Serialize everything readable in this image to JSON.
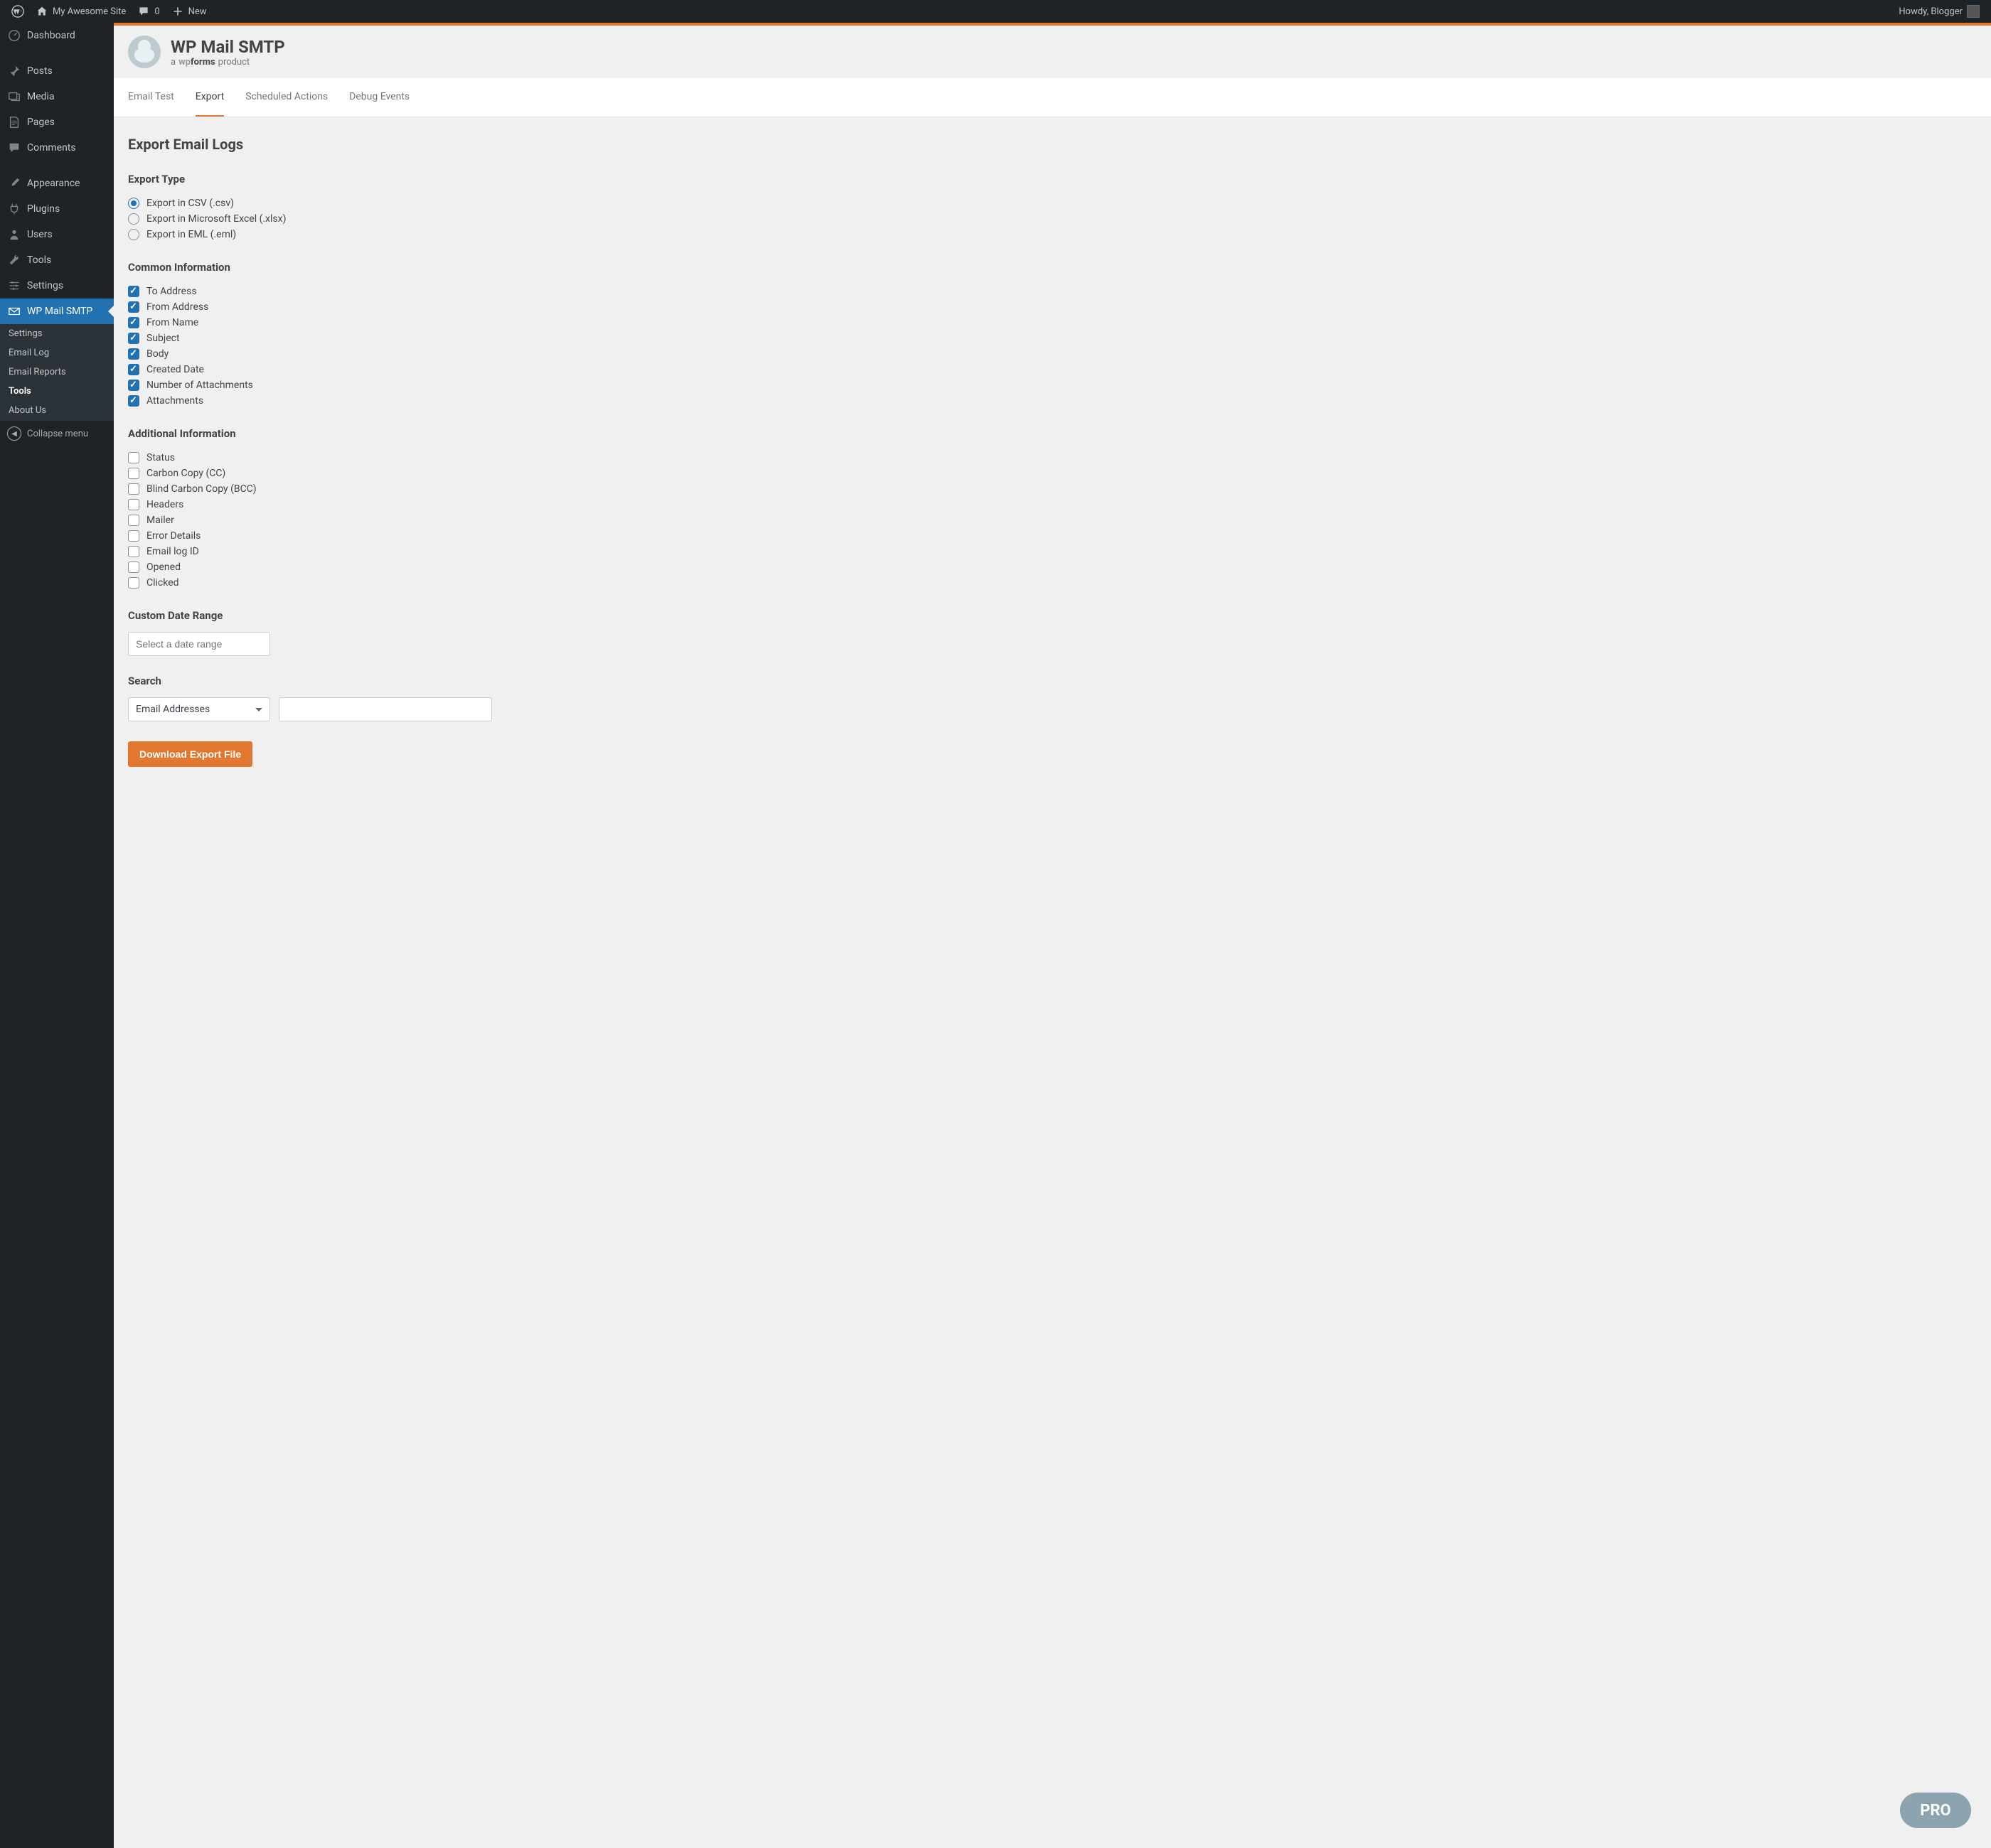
{
  "adminbar": {
    "site_name": "My Awesome Site",
    "comments_count": "0",
    "new_label": "New",
    "howdy": "Howdy, Blogger"
  },
  "sidebar": {
    "items": [
      {
        "icon": "dashboard",
        "label": "Dashboard"
      },
      {
        "icon": "posts",
        "label": "Posts"
      },
      {
        "icon": "media",
        "label": "Media"
      },
      {
        "icon": "pages",
        "label": "Pages"
      },
      {
        "icon": "comments",
        "label": "Comments"
      },
      {
        "icon": "appearance",
        "label": "Appearance"
      },
      {
        "icon": "plugins",
        "label": "Plugins"
      },
      {
        "icon": "users",
        "label": "Users"
      },
      {
        "icon": "tools",
        "label": "Tools"
      },
      {
        "icon": "settings",
        "label": "Settings"
      },
      {
        "icon": "mail",
        "label": "WP Mail SMTP"
      }
    ],
    "sub_items": [
      {
        "label": "Settings"
      },
      {
        "label": "Email Log"
      },
      {
        "label": "Email Reports"
      },
      {
        "label": "Tools"
      },
      {
        "label": "About Us"
      }
    ],
    "collapse_label": "Collapse menu"
  },
  "header": {
    "title": "WP Mail SMTP",
    "subtitle_prefix": "a",
    "subtitle_brand_wp": "wp",
    "subtitle_brand_forms": "forms",
    "subtitle_suffix": "product"
  },
  "tabs": [
    {
      "label": "Email Test"
    },
    {
      "label": "Export"
    },
    {
      "label": "Scheduled Actions"
    },
    {
      "label": "Debug Events"
    }
  ],
  "page": {
    "title": "Export Email Logs",
    "sections": {
      "export_type": {
        "title": "Export Type",
        "options": [
          {
            "label": "Export in CSV (.csv)",
            "checked": true
          },
          {
            "label": "Export in Microsoft Excel (.xlsx)",
            "checked": false
          },
          {
            "label": "Export in EML (.eml)",
            "checked": false
          }
        ]
      },
      "common_info": {
        "title": "Common Information",
        "options": [
          {
            "label": "To Address",
            "checked": true
          },
          {
            "label": "From Address",
            "checked": true
          },
          {
            "label": "From Name",
            "checked": true
          },
          {
            "label": "Subject",
            "checked": true
          },
          {
            "label": "Body",
            "checked": true
          },
          {
            "label": "Created Date",
            "checked": true
          },
          {
            "label": "Number of Attachments",
            "checked": true
          },
          {
            "label": "Attachments",
            "checked": true
          }
        ]
      },
      "additional_info": {
        "title": "Additional Information",
        "options": [
          {
            "label": "Status",
            "checked": false
          },
          {
            "label": "Carbon Copy (CC)",
            "checked": false
          },
          {
            "label": "Blind Carbon Copy (BCC)",
            "checked": false
          },
          {
            "label": "Headers",
            "checked": false
          },
          {
            "label": "Mailer",
            "checked": false
          },
          {
            "label": "Error Details",
            "checked": false
          },
          {
            "label": "Email log ID",
            "checked": false
          },
          {
            "label": "Opened",
            "checked": false
          },
          {
            "label": "Clicked",
            "checked": false
          }
        ]
      },
      "date_range": {
        "title": "Custom Date Range",
        "placeholder": "Select a date range"
      },
      "search": {
        "title": "Search",
        "select_value": "Email Addresses",
        "input_value": ""
      }
    },
    "download_btn": "Download Export File",
    "pro_badge": "PRO"
  }
}
